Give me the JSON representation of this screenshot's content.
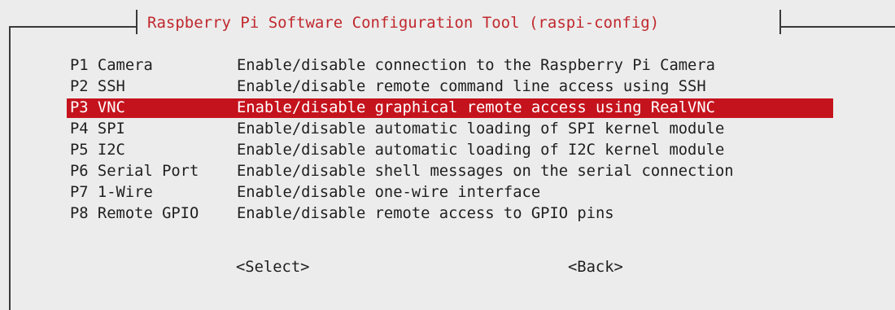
{
  "dialog": {
    "title": "Raspberry Pi Software Configuration Tool (raspi-config)"
  },
  "menu": {
    "selected_index": 2,
    "items": [
      {
        "key": "P1 Camera",
        "description": "Enable/disable connection to the Raspberry Pi Camera"
      },
      {
        "key": "P2 SSH",
        "description": "Enable/disable remote command line access using SSH"
      },
      {
        "key": "P3 VNC",
        "description": "Enable/disable graphical remote access using RealVNC"
      },
      {
        "key": "P4 SPI",
        "description": "Enable/disable automatic loading of SPI kernel module"
      },
      {
        "key": "P5 I2C",
        "description": "Enable/disable automatic loading of I2C kernel module"
      },
      {
        "key": "P6 Serial Port",
        "description": "Enable/disable shell messages on the serial connection"
      },
      {
        "key": "P7 1-Wire",
        "description": "Enable/disable one-wire interface"
      },
      {
        "key": "P8 Remote GPIO",
        "description": "Enable/disable remote access to GPIO pins"
      }
    ]
  },
  "buttons": {
    "select_label": "<Select>",
    "back_label": "<Back>"
  },
  "colors": {
    "title": "#c0282d",
    "highlight": "#c5131d",
    "background": "#ececec"
  }
}
